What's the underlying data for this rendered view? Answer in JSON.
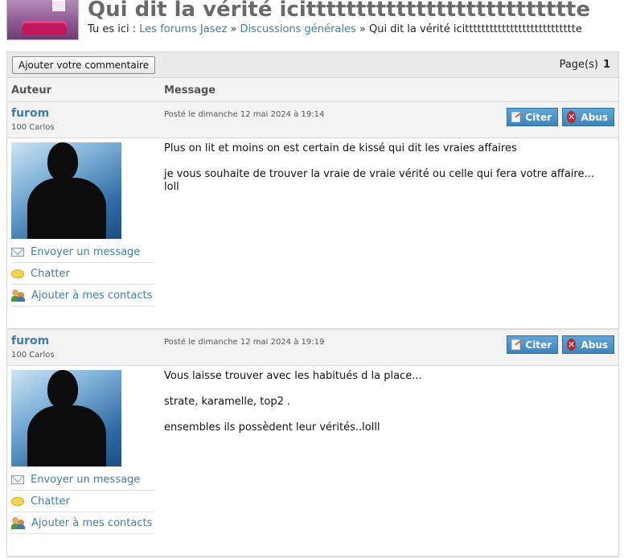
{
  "header": {
    "title": "Qui dit la vérité icittttttttttttttttttttttttttte",
    "breadcrumb_prefix": "Tu es ici :",
    "crumb1": "Les forums Jasez",
    "crumb2": "Discussions générales",
    "crumb_current": "Qui dit la vérité icittttttttttttttttttttttttttte",
    "sep": "»"
  },
  "toolbar": {
    "add_comment_label": "Ajouter votre commentaire",
    "pages_label": "Page(s)",
    "page_number": "1"
  },
  "table": {
    "col_author": "Auteur",
    "col_message": "Message"
  },
  "posts": [
    {
      "author": "furom",
      "rank": "100 Carlos",
      "date": "Posté le dimanche 12 mai 2024 à 19:14",
      "quote_label": "Citer",
      "abuse_label": "Abus",
      "send_message": "Envoyer un message",
      "chat": "Chatter",
      "add_contact": "Ajouter à mes contacts",
      "paragraphs": [
        "Plus on lit et moins on est certain de kissé qui dit les vraies affaires",
        "je vous souhaite de trouver la vraie de vraie vérité ou celle qui fera votre affaire... loll"
      ]
    },
    {
      "author": "furom",
      "rank": "100 Carlos",
      "date": "Posté le dimanche 12 mai 2024 à 19:19",
      "quote_label": "Citer",
      "abuse_label": "Abus",
      "send_message": "Envoyer un message",
      "chat": "Chatter",
      "add_contact": "Ajouter à mes contacts",
      "paragraphs": [
        "Vous laisse trouver avec les habitués d la place...",
        "strate, karamelle, top2 .",
        "ensembles ils possèdent leur vérités..lolll"
      ]
    }
  ],
  "colors": {
    "link": "#3d7fa6",
    "button_blue": "#4a93c9",
    "abuse_red": "#c0262b"
  }
}
